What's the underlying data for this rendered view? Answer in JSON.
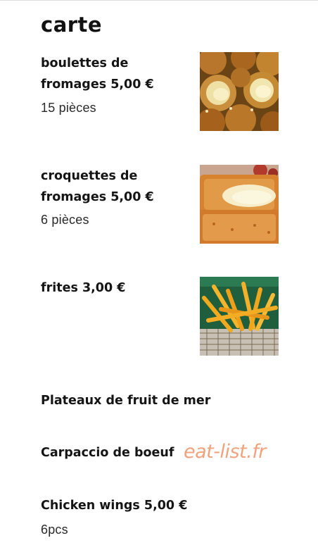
{
  "menu": {
    "title": "carte",
    "items": [
      {
        "name": "boulettes de fromages 5,00 €",
        "description": "15 pièces",
        "photo": "fried cheese balls"
      },
      {
        "name": "croquettes de fromages 5,00 €",
        "description": "6 pièces",
        "photo": "cheese croquettes"
      },
      {
        "name": "frites 3,00 €",
        "photo": "french fries in basket"
      },
      {
        "name": "Plateaux de fruit de mer"
      },
      {
        "name": "Carpaccio de boeuf"
      },
      {
        "name": "Chicken wings 5,00 €",
        "description": "6pcs"
      }
    ]
  },
  "watermark": "eat-list.fr"
}
